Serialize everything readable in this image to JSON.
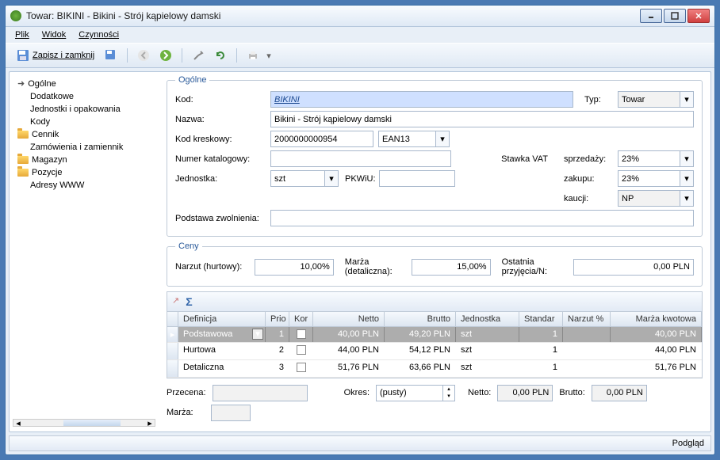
{
  "title": "Towar: BIKINI - Bikini - Strój kąpielowy damski",
  "menu": {
    "plik": "Plik",
    "widok": "Widok",
    "czynnosci": "Czynności"
  },
  "toolbar": {
    "save": "Zapisz i zamknij"
  },
  "nav": {
    "ogolne": "Ogólne",
    "dodatkowe": "Dodatkowe",
    "jednostki": "Jednostki i opakowania",
    "kody": "Kody",
    "cennik": "Cennik",
    "zamowienia": "Zamówienia i zamiennik",
    "magazyn": "Magazyn",
    "pozycje": "Pozycje",
    "adresy": "Adresy WWW"
  },
  "section": {
    "ogolne": "Ogólne",
    "ceny": "Ceny"
  },
  "labels": {
    "kod": "Kod:",
    "typ": "Typ:",
    "nazwa": "Nazwa:",
    "kod_kreskowy": "Kod kreskowy:",
    "numer_kat": "Numer katalogowy:",
    "stawka_vat": "Stawka VAT",
    "sprzedazy": "sprzedaży:",
    "jednostka": "Jednostka:",
    "pkwiu": "PKWiU:",
    "zakupu": "zakupu:",
    "kaucji": "kaucji:",
    "podstawa": "Podstawa zwolnienia:",
    "narzut_hurt": "Narzut (hurtowy):",
    "marza_det": "Marża (detaliczna):",
    "ostatnia": "Ostatnia przyjęcia/N:",
    "przecena": "Przecena:",
    "okres": "Okres:",
    "netto": "Netto:",
    "brutto": "Brutto:",
    "marza": "Marża:"
  },
  "values": {
    "kod": "BIKINI",
    "typ": "Towar",
    "nazwa": "Bikini - Strój kąpielowy damski",
    "kod_kreskowy": "2000000000954",
    "barcode_type": "EAN13",
    "numer_kat": "",
    "vat_sprzedazy": "23%",
    "jednostka": "szt",
    "pkwiu": "",
    "vat_zakupu": "23%",
    "vat_kaucji": "NP",
    "podstawa": "",
    "narzut_hurt": "10,00%",
    "marza_det": "15,00%",
    "ostatnia": "0,00 PLN",
    "okres": "(pusty)",
    "netto": "0,00 PLN",
    "brutto": "0,00 PLN"
  },
  "grid": {
    "headers": [
      "Definicja",
      "Prio",
      "Kor",
      "Netto",
      "Brutto",
      "Jednostka",
      "Standar",
      "Narzut %",
      "Marża kwotowa"
    ],
    "rows": [
      {
        "def": "Podstawowa",
        "prio": "1",
        "kor": true,
        "netto": "40,00 PLN",
        "brutto": "49,20 PLN",
        "jedn": "szt",
        "stand": "1",
        "narzut": "",
        "marza": "40,00 PLN"
      },
      {
        "def": "Hurtowa",
        "prio": "2",
        "kor": false,
        "netto": "44,00 PLN",
        "brutto": "54,12 PLN",
        "jedn": "szt",
        "stand": "1",
        "narzut": "",
        "marza": "44,00 PLN"
      },
      {
        "def": "Detaliczna",
        "prio": "3",
        "kor": false,
        "netto": "51,76 PLN",
        "brutto": "63,66 PLN",
        "jedn": "szt",
        "stand": "1",
        "narzut": "",
        "marza": "51,76 PLN"
      }
    ]
  },
  "status": {
    "podglad": "Podgląd"
  }
}
